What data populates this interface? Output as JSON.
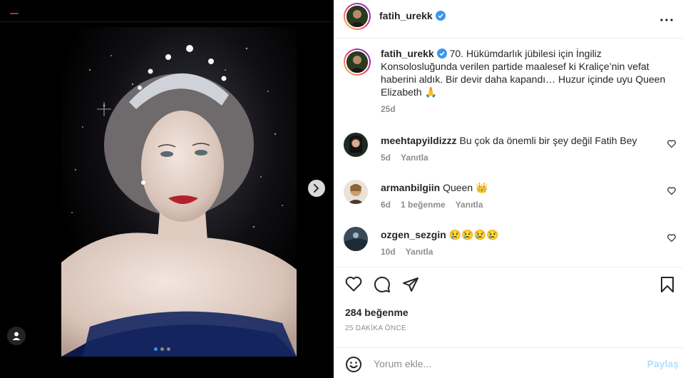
{
  "post": {
    "username": "fatih_urekk",
    "more_icon": "more-horizontal-icon",
    "caption": "70. Hükümdarlık jübilesi için İngiliz Konsolosluğunda verilen partide maalesef ki Kraliçe’nin vefat haberini aldık. Bir devir daha kapandı… Huzur içinde uyu Queen Elizabeth 🙏",
    "caption_time": "25d",
    "likes": "284 beğenme",
    "posted_ago": "25 DAKİKA ÖNCE",
    "carousel": {
      "count": 3,
      "active": 0
    }
  },
  "comments": [
    {
      "username": "meehtapyildizzz",
      "text": "Bu çok da önemli bir şey değil Fatih Bey",
      "time": "5d",
      "likes": "",
      "reply": "Yanıtla"
    },
    {
      "username": "armanbilgiin",
      "text": "Queen 👑",
      "time": "6d",
      "likes": "1 beğenme",
      "reply": "Yanıtla"
    },
    {
      "username": "ozgen_sezgin",
      "text": "😢😢😢😢",
      "time": "10d",
      "likes": "",
      "reply": "Yanıtla"
    }
  ],
  "composer": {
    "placeholder": "Yorum ekle...",
    "share_label": "Paylaş"
  },
  "colors": {
    "verified": "#3897f0",
    "link_disabled": "#b2dffc",
    "muted": "#8e8e8e"
  }
}
